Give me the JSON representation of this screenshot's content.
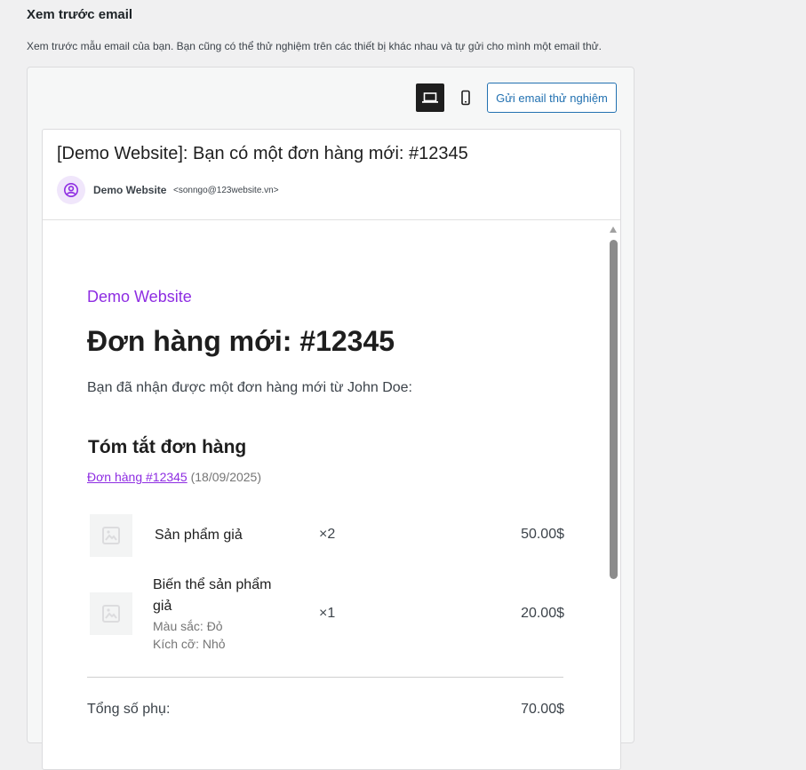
{
  "section": {
    "title": "Xem trước email",
    "description": "Xem trước mẫu email của bạn. Bạn cũng có thể thử nghiệm trên các thiết bị khác nhau và tự gửi cho mình một email thử."
  },
  "toolbar": {
    "desktop_icon": "laptop-icon",
    "mobile_icon": "smartphone-icon",
    "send_test_label": "Gửi email thử nghiệm"
  },
  "email": {
    "subject": "[Demo Website]: Bạn có một đơn hàng mới: #12345",
    "sender_name": "Demo Website",
    "sender_email": "<sonngo@123website.vn>",
    "store_name": "Demo Website",
    "heading": "Đơn hàng mới: #12345",
    "intro": "Bạn đã nhận được một đơn hàng mới từ John Doe:",
    "summary_title": "Tóm tắt đơn hàng",
    "order_link": "Đơn hàng #12345",
    "order_date": "(18/09/2025)",
    "items": [
      {
        "name": "Sản phẩm giả",
        "quantity": "×2",
        "price": "50.00$"
      },
      {
        "name_line1": "Biến thể sản phẩm",
        "name_line2": "giả",
        "meta_color": "Màu sắc: Đỏ",
        "meta_size": "Kích cỡ: Nhỏ",
        "quantity": "×1",
        "price": "20.00$"
      }
    ],
    "subtotal_label": "Tổng số phụ:",
    "subtotal_value": "70.00$"
  },
  "colors": {
    "accent": "#8e2de2",
    "button": "#2271b1"
  }
}
